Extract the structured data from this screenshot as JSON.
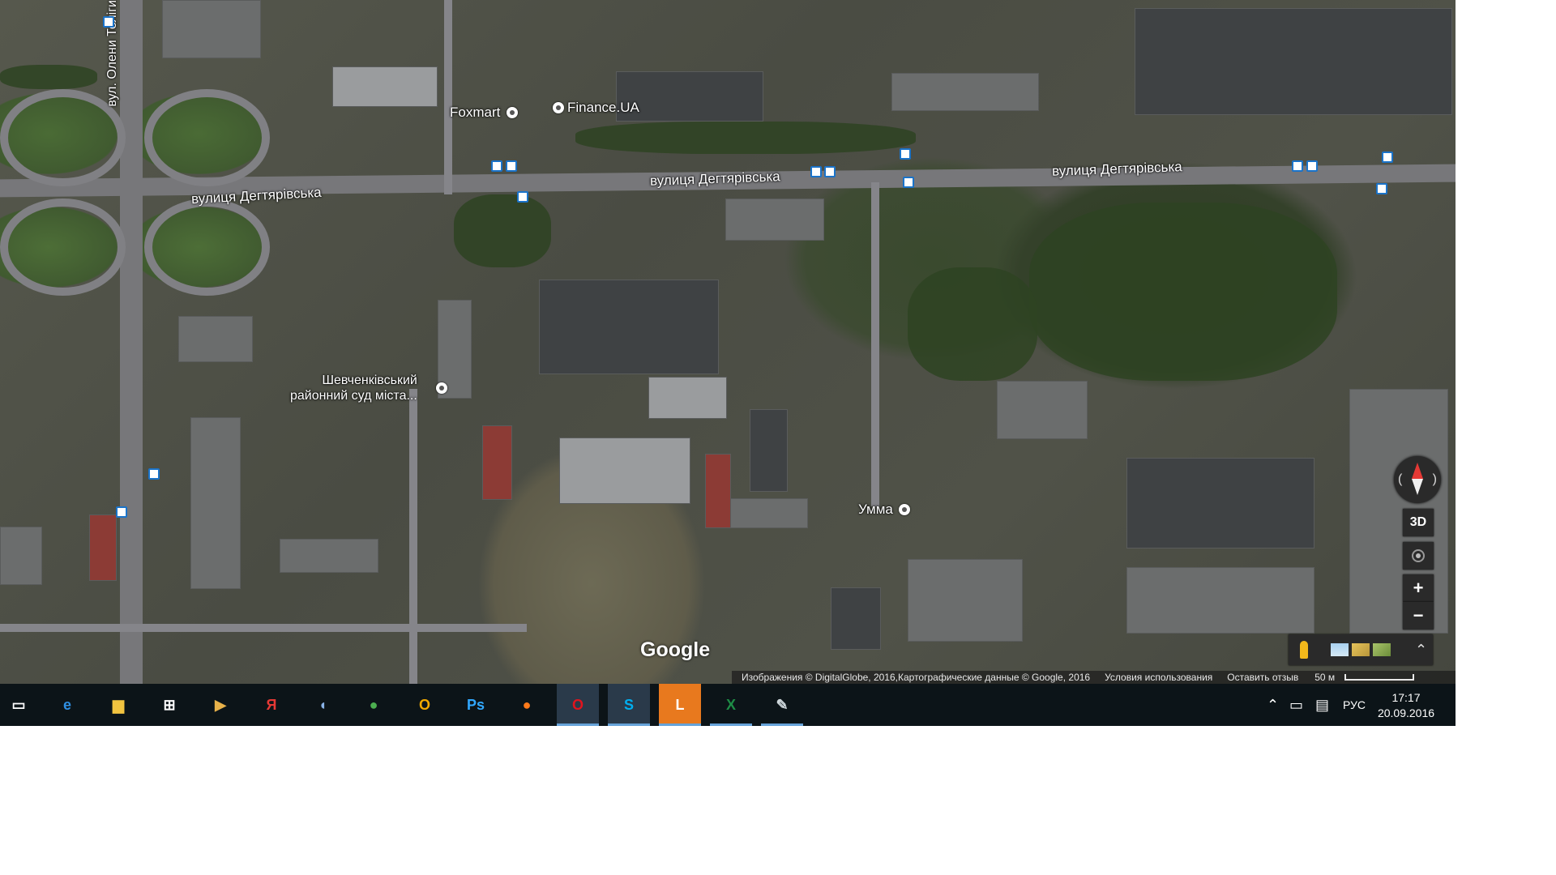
{
  "map": {
    "labels": {
      "street_1": "вулиця Дегтярівська",
      "street_2": "вулиця Дегтярівська",
      "street_3": "вулиця Дегтярівська",
      "street_vertical": "вул. Олени Теліги"
    },
    "pois": {
      "foxmart": "Foxmart",
      "finance": "Finance.UA",
      "court_line1": "Шевченківський",
      "court_line2": "районний суд міста...",
      "umma": "Умма"
    },
    "logo": "Google",
    "footer": {
      "attribution": "Изображения © DigitalGlobe, 2016,Картографические данные © Google, 2016",
      "terms": "Условия использования",
      "feedback": "Оставить отзыв",
      "scale": "50 м"
    },
    "controls": {
      "three_d": "3D",
      "zoom_in": "+",
      "zoom_out": "−"
    }
  },
  "taskbar": {
    "apps": [
      {
        "name": "task-view",
        "glyph": "▭",
        "color": "#ffffff"
      },
      {
        "name": "edge",
        "glyph": "e",
        "color": "#2f8fe3"
      },
      {
        "name": "file-explorer",
        "glyph": "▆",
        "color": "#f2c440"
      },
      {
        "name": "store",
        "glyph": "⊞",
        "color": "#ffffff"
      },
      {
        "name": "media-player",
        "glyph": "▶",
        "color": "#e8b24a"
      },
      {
        "name": "yandex",
        "glyph": "Я",
        "color": "#e53935"
      },
      {
        "name": "volume-app",
        "glyph": "◖",
        "color": "#8ab4e8"
      },
      {
        "name": "chrome",
        "glyph": "●",
        "color": "#4caf50"
      },
      {
        "name": "outlook",
        "glyph": "O",
        "color": "#f2a900"
      },
      {
        "name": "photoshop",
        "glyph": "Ps",
        "color": "#31a8ff"
      },
      {
        "name": "firefox",
        "glyph": "●",
        "color": "#ff7a1a"
      },
      {
        "name": "opera",
        "glyph": "O",
        "color": "#e0141e"
      },
      {
        "name": "skype",
        "glyph": "S",
        "color": "#00aff0"
      },
      {
        "name": "line",
        "glyph": "L",
        "color": "#ffffff"
      },
      {
        "name": "excel",
        "glyph": "X",
        "color": "#1e8c46"
      },
      {
        "name": "paint",
        "glyph": "✎",
        "color": "#cfd8dc"
      }
    ],
    "tray": {
      "language": "РУС",
      "time": "17:17",
      "date": "20.09.2016"
    }
  }
}
